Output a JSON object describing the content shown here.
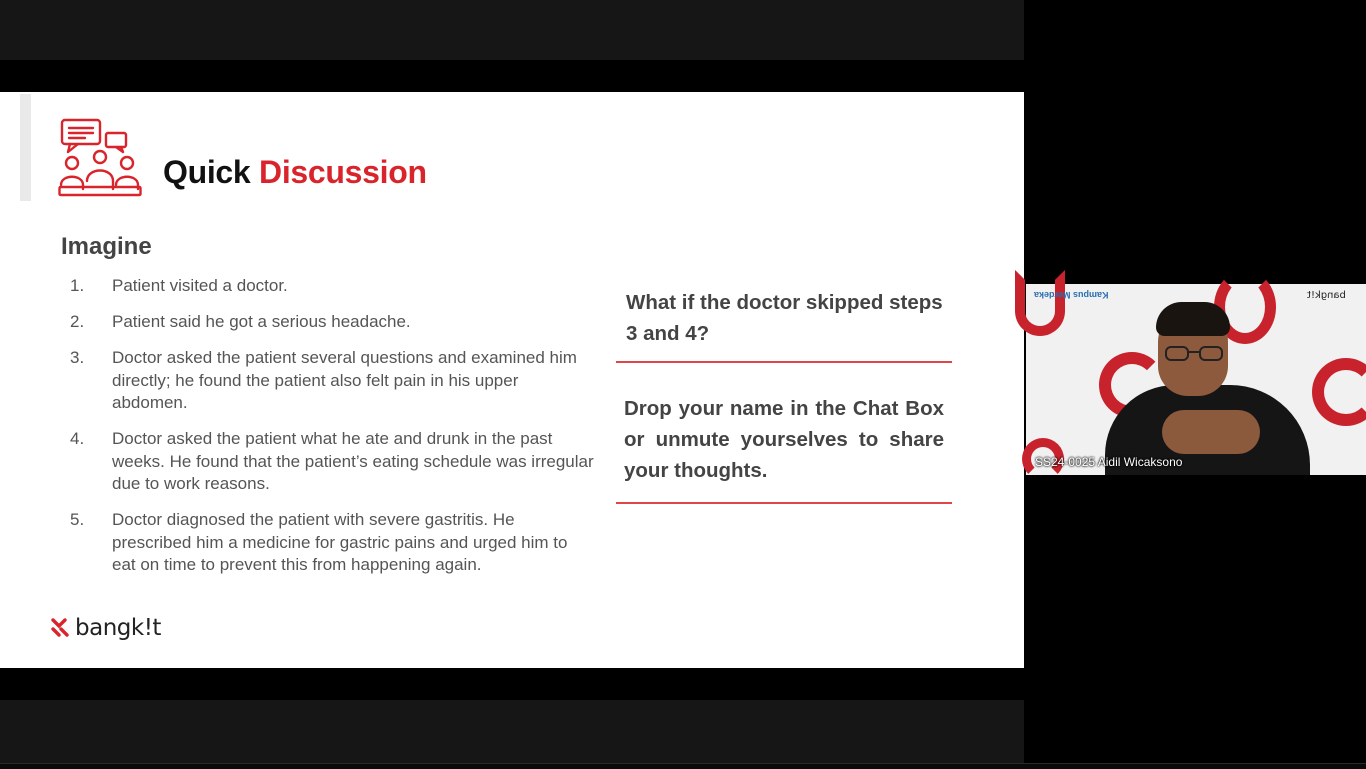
{
  "slide": {
    "title_main": "Quick",
    "title_accent": "Discussion",
    "section_heading": "Imagine",
    "steps": [
      {
        "num": "1.",
        "text": "Patient visited a doctor."
      },
      {
        "num": "2.",
        "text": "Patient said he got a serious headache."
      },
      {
        "num": "3.",
        "text": "Doctor asked the patient several questions and examined him directly; he found the patient also felt pain in his upper abdomen."
      },
      {
        "num": "4.",
        "text": "Doctor asked the patient what he ate and drunk in the past weeks. He found that the patient’s eating schedule was irregular due to work reasons."
      },
      {
        "num": "5.",
        "text": "Doctor diagnosed the patient with severe gastritis. He prescribed him a medicine for gastric pains and urged him to eat on time to prevent this from happening again."
      }
    ],
    "question": "What if the doctor skipped steps 3 and 4?",
    "prompt": "Drop your name in the Chat Box or unmute yourselves to share your thoughts.",
    "logo_text": "bangk!t",
    "accent_color": "#d9242b",
    "icon": "discussion-group-icon"
  },
  "video": {
    "participant_name": "SS24-0025 Aidil Wicaksono",
    "background_logo_left": "Kampus Merdeka",
    "background_logo_right": "bangk!t"
  }
}
